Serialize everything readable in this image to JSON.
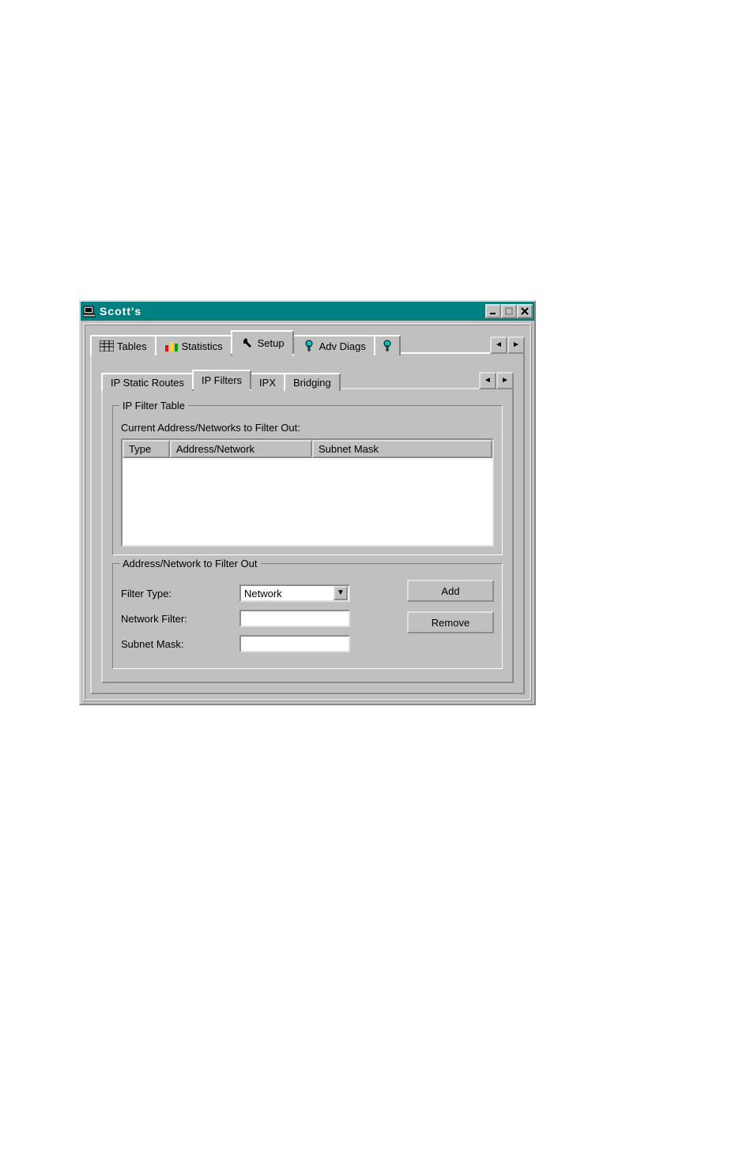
{
  "window": {
    "title": "Scott's"
  },
  "mainTabs": {
    "items": [
      {
        "label": "Tables"
      },
      {
        "label": "Statistics"
      },
      {
        "label": "Setup"
      },
      {
        "label": "Adv Diags"
      }
    ]
  },
  "subTabs": {
    "items": [
      {
        "label": "IP Static Routes"
      },
      {
        "label": "IP Filters"
      },
      {
        "label": "IPX"
      },
      {
        "label": "Bridging"
      }
    ]
  },
  "filterTable": {
    "groupTitle": "IP Filter Table",
    "caption": "Current Address/Networks to Filter Out:",
    "columns": {
      "c1": "Type",
      "c2": "Address/Network",
      "c3": "Subnet Mask"
    }
  },
  "filterForm": {
    "groupTitle": "Address/Network to Filter Out",
    "labels": {
      "filterType": "Filter Type:",
      "networkFilter": "Network Filter:",
      "subnetMask": "Subnet Mask:"
    },
    "filterTypeValue": "Network",
    "networkFilterValue": "",
    "subnetMaskValue": ""
  },
  "buttons": {
    "add": "Add",
    "remove": "Remove"
  }
}
